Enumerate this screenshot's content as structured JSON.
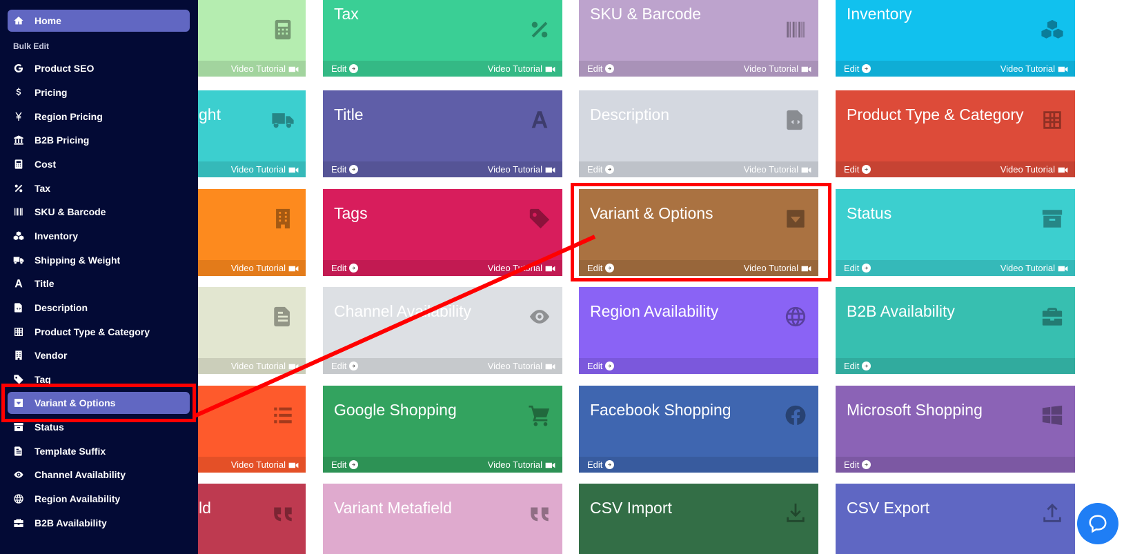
{
  "sidebar": {
    "section_label": "Bulk Edit",
    "items": [
      {
        "label": "Home",
        "icon": "home-icon"
      },
      {
        "label": "Product SEO",
        "icon": "google-icon"
      },
      {
        "label": "Pricing",
        "icon": "dollar-icon"
      },
      {
        "label": "Region Pricing",
        "icon": "yen-icon"
      },
      {
        "label": "B2B Pricing",
        "icon": "bank-icon"
      },
      {
        "label": "Cost",
        "icon": "calculator-icon"
      },
      {
        "label": "Tax",
        "icon": "percent-icon"
      },
      {
        "label": "SKU & Barcode",
        "icon": "barcode-icon"
      },
      {
        "label": "Inventory",
        "icon": "cubes-icon"
      },
      {
        "label": "Shipping & Weight",
        "icon": "truck-icon"
      },
      {
        "label": "Title",
        "icon": "font-icon"
      },
      {
        "label": "Description",
        "icon": "file-code-icon"
      },
      {
        "label": "Product Type & Category",
        "icon": "grid-icon"
      },
      {
        "label": "Vendor",
        "icon": "building-icon"
      },
      {
        "label": "Tag",
        "icon": "tag-icon"
      },
      {
        "label": "Variant & Options",
        "icon": "caret-square-icon"
      },
      {
        "label": "Status",
        "icon": "archive-icon"
      },
      {
        "label": "Template Suffix",
        "icon": "file-text-icon"
      },
      {
        "label": "Channel Availability",
        "icon": "eye-icon"
      },
      {
        "label": "Region Availability",
        "icon": "globe-icon"
      },
      {
        "label": "B2B Availability",
        "icon": "briefcase-icon"
      }
    ]
  },
  "cards": [
    {
      "title": "",
      "icon": "calculator-icon",
      "edit": "",
      "video": "Video Tutorial",
      "color": "#b5edb0"
    },
    {
      "title": "Tax",
      "icon": "percent-icon",
      "edit": "Edit",
      "video": "Video Tutorial",
      "color": "#3acf95"
    },
    {
      "title": "SKU & Barcode",
      "icon": "barcode-icon",
      "edit": "Edit",
      "video": "Video Tutorial",
      "color": "#bda3cd"
    },
    {
      "title": "Inventory",
      "icon": "cubes-icon",
      "edit": "Edit",
      "video": "Video Tutorial",
      "color": "#11c1ee"
    },
    {
      "title": "ght",
      "icon": "truck-icon",
      "edit": "",
      "video": "Video Tutorial",
      "color": "#3ccfcf"
    },
    {
      "title": "Title",
      "icon": "font-icon",
      "edit": "Edit",
      "video": "Video Tutorial",
      "color": "#5f5ea8"
    },
    {
      "title": "Description",
      "icon": "file-code-icon",
      "edit": "Edit",
      "video": "Video Tutorial",
      "color": "#d4d8e0"
    },
    {
      "title": "Product Type & Category",
      "icon": "grid-icon",
      "edit": "Edit",
      "video": "Video Tutorial",
      "color": "#dd4b39"
    },
    {
      "title": "",
      "icon": "building-icon",
      "edit": "",
      "video": "Video Tutorial",
      "color": "#fd8a1e"
    },
    {
      "title": "Tags",
      "icon": "tag-icon",
      "edit": "Edit",
      "video": "Video Tutorial",
      "color": "#d81d5c"
    },
    {
      "title": "Variant & Options",
      "icon": "caret-square-icon",
      "edit": "Edit",
      "video": "Video Tutorial",
      "color": "#aa7241"
    },
    {
      "title": "Status",
      "icon": "archive-icon",
      "edit": "Edit",
      "video": "Video Tutorial",
      "color": "#3ccfcf"
    },
    {
      "title": "",
      "icon": "file-text-icon",
      "edit": "",
      "video": "Video Tutorial",
      "color": "#e2e6d0"
    },
    {
      "title": "Channel Availability",
      "icon": "eye-icon",
      "edit": "Edit",
      "video": "Video Tutorial",
      "color": "#dde0e4"
    },
    {
      "title": "Region Availability",
      "icon": "globe-icon",
      "edit": "Edit",
      "video": "",
      "color": "#8a63f5"
    },
    {
      "title": "B2B Availability",
      "icon": "briefcase-icon",
      "edit": "Edit",
      "video": "",
      "color": "#37bfb0"
    },
    {
      "title": "",
      "icon": "list-icon",
      "edit": "",
      "video": "Video Tutorial",
      "color": "#fe5a2c"
    },
    {
      "title": "Google Shopping",
      "icon": "cart-icon",
      "edit": "Edit",
      "video": "Video Tutorial",
      "color": "#33a35f"
    },
    {
      "title": "Facebook Shopping",
      "icon": "facebook-icon",
      "edit": "Edit",
      "video": "",
      "color": "#3f66b0"
    },
    {
      "title": "Microsoft Shopping",
      "icon": "windows-icon",
      "edit": "Edit",
      "video": "",
      "color": "#8b63b6"
    },
    {
      "title": "ld",
      "icon": "quote-icon",
      "edit": "",
      "video": "",
      "color": "#be3a50"
    },
    {
      "title": "Variant Metafield",
      "icon": "quote-icon",
      "edit": "",
      "video": "",
      "color": "#dfaace"
    },
    {
      "title": "CSV Import",
      "icon": "download-icon",
      "edit": "",
      "video": "",
      "color": "#336e46"
    },
    {
      "title": "CSV Export",
      "icon": "upload-icon",
      "edit": "",
      "video": "",
      "color": "#5f67c3"
    }
  ],
  "help": {
    "icon": "chat-bubble-icon"
  },
  "annotation": {
    "color": "#ff0000"
  }
}
